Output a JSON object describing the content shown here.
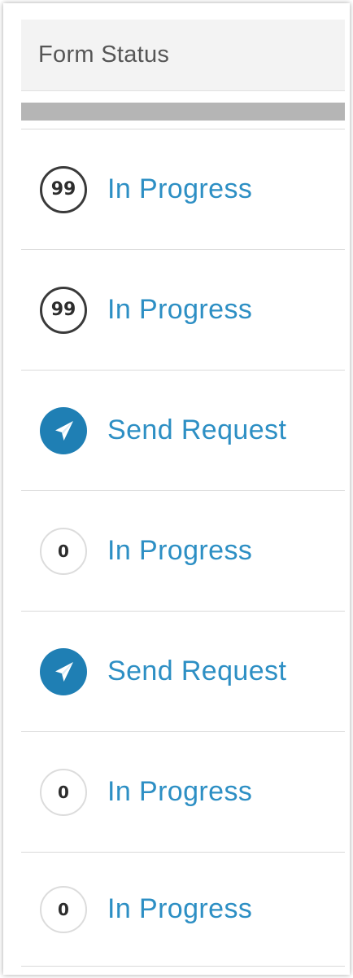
{
  "header": {
    "title": "Form Status"
  },
  "colors": {
    "link": "#2d8fc4",
    "send_badge": "#1f7fb4",
    "header_bg": "#f3f3f3",
    "filter_bar": "#b5b5b5"
  },
  "rows": [
    {
      "badge_type": "count",
      "badge_text": "99",
      "status": "In Progress",
      "icon": "count-circle-icon"
    },
    {
      "badge_type": "count",
      "badge_text": "99",
      "status": "In Progress",
      "icon": "count-circle-icon"
    },
    {
      "badge_type": "send",
      "badge_text": "",
      "status": "Send Request",
      "icon": "paper-plane-icon"
    },
    {
      "badge_type": "count",
      "badge_text": "0",
      "status": "In Progress",
      "icon": "count-circle-icon"
    },
    {
      "badge_type": "send",
      "badge_text": "",
      "status": "Send Request",
      "icon": "paper-plane-icon"
    },
    {
      "badge_type": "count",
      "badge_text": "0",
      "status": "In Progress",
      "icon": "count-circle-icon"
    },
    {
      "badge_type": "count",
      "badge_text": "0",
      "status": "In Progress",
      "icon": "count-circle-icon"
    }
  ]
}
